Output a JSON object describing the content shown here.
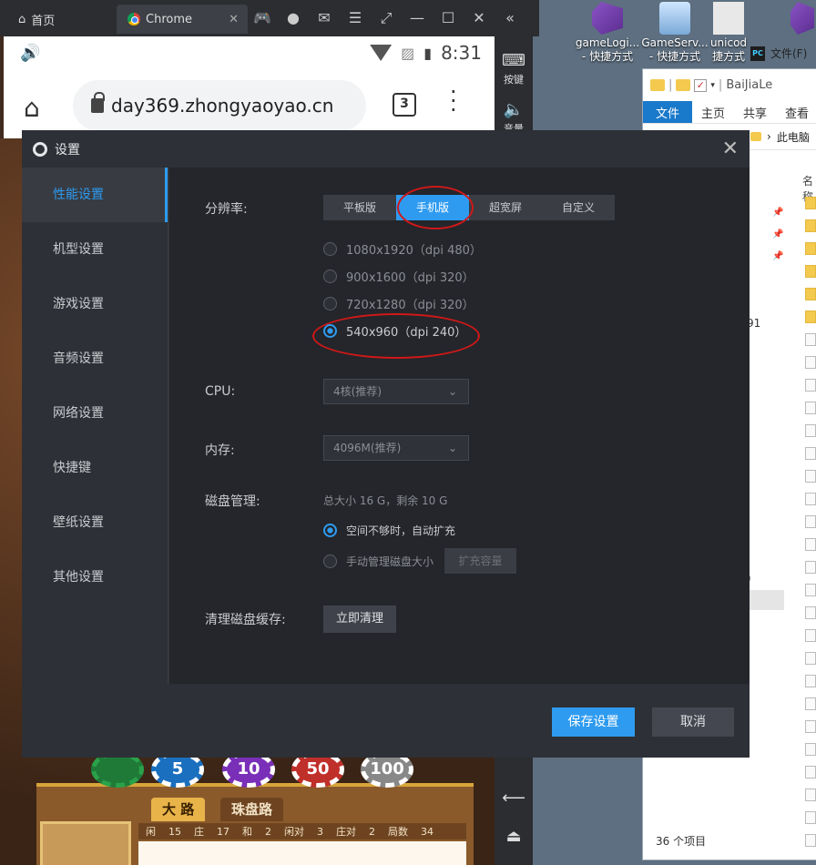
{
  "emulator_tabs": {
    "home": "首页",
    "chrome": "Chrome",
    "close": "✕"
  },
  "android_status": {
    "time": "8:31"
  },
  "chrome": {
    "url": "day369.zhongyaoyao.cn",
    "tab_count": "3"
  },
  "emulator_side": {
    "keys_label": "按键",
    "volume_label": "音量"
  },
  "desktop_icons": [
    {
      "label": "gameLogi...",
      "sub": "- 快捷方式"
    },
    {
      "label": "GameServ...",
      "sub": "- 快捷方式"
    },
    {
      "label": "unicod",
      "sub": "捷方式"
    }
  ],
  "explorer": {
    "title": "BaiJiaLe",
    "ribbon": [
      "文件",
      "主页",
      "共享",
      "查看"
    ],
    "breadcrumb": "此电脑",
    "column": "名称",
    "item_count": "36 个项目",
    "pc_tag": "文件(F)",
    "side_texts": [
      "91",
      ")",
      ":"
    ]
  },
  "dialog": {
    "title": "设置",
    "sidebar": [
      "性能设置",
      "机型设置",
      "游戏设置",
      "音频设置",
      "网络设置",
      "快捷键",
      "壁纸设置",
      "其他设置"
    ],
    "resolution_label": "分辨率:",
    "resolution_tabs": [
      "平板版",
      "手机版",
      "超宽屏",
      "自定义"
    ],
    "resolutions": [
      "1080x1920（dpi 480）",
      "900x1600（dpi 320）",
      "720x1280（dpi 320）",
      "540x960（dpi 240）"
    ],
    "cpu_label": "CPU:",
    "cpu_value": "4核(推荐)",
    "memory_label": "内存:",
    "memory_value": "4096M(推荐)",
    "disk_label": "磁盘管理:",
    "disk_info": "总大小 16 G，剩余 10 G",
    "disk_auto": "空间不够时，自动扩充",
    "disk_manual": "手动管理磁盘大小",
    "expand_button": "扩充容量",
    "cache_label": "清理磁盘缓存:",
    "cache_button": "立即清理",
    "save_button": "保存设置",
    "cancel_button": "取消"
  },
  "game": {
    "road_tabs": [
      "大 路",
      "珠盘路"
    ],
    "chips": [
      "5",
      "10",
      "50",
      "100"
    ],
    "score_strip": [
      "闲",
      "15",
      "庄",
      "17",
      "和",
      "2",
      "闲对",
      "3",
      "庄对",
      "2",
      "局数",
      "34"
    ]
  },
  "colors": {
    "accent": "#2e9bf0",
    "annotation": "#d01818",
    "dialog_bg": "#2d3036"
  }
}
